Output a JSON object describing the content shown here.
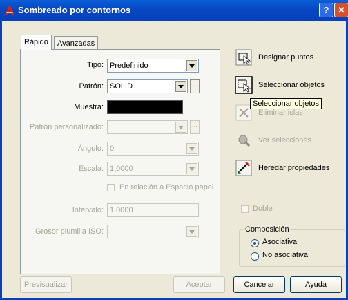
{
  "window": {
    "title": "Sombreado por contornos",
    "help_label": "?",
    "close_label": "✕"
  },
  "tabs": [
    {
      "label": "Rápido"
    },
    {
      "label": "Avanzadas"
    }
  ],
  "form": {
    "tipo": {
      "label": "Tipo:",
      "value": "Predefinido"
    },
    "patron": {
      "label": "Patrón:",
      "value": "SOLID",
      "ellipsis": "..."
    },
    "muestra": {
      "label": "Muestra:",
      "color": "#000000"
    },
    "patron_personalizado": {
      "label": "Patrón personalizado:",
      "value": "",
      "ellipsis": "..."
    },
    "angulo": {
      "label": "Ángulo:",
      "value": "0"
    },
    "escala": {
      "label": "Escala:",
      "value": "1.0000"
    },
    "relacion_checkbox": {
      "label": "En relación a Espacio papel",
      "checked": false
    },
    "intervalo": {
      "label": "Intervalo:",
      "value": "1.0000"
    },
    "grosor": {
      "label": "Grosor plumilla ISO:",
      "value": ""
    }
  },
  "right_actions": {
    "designar_puntos": "Designar puntos",
    "seleccionar_objetos": "Seleccionar objetos",
    "eliminar_islas": "Eliminar islas",
    "ver_selecciones": "Ver selecciones",
    "heredar_propiedades": "Heredar propiedades",
    "tooltip": "Seleccionar objetos"
  },
  "doble": {
    "label": "Doble",
    "checked": false
  },
  "composicion": {
    "legend": "Composición",
    "options": [
      {
        "label": "Asociativa",
        "selected": true
      },
      {
        "label": "No asociativa",
        "selected": false
      }
    ]
  },
  "buttons": {
    "previsualizar": "Previsualizar",
    "aceptar": "Aceptar",
    "cancelar": "Cancelar",
    "ayuda": "Ayuda"
  }
}
